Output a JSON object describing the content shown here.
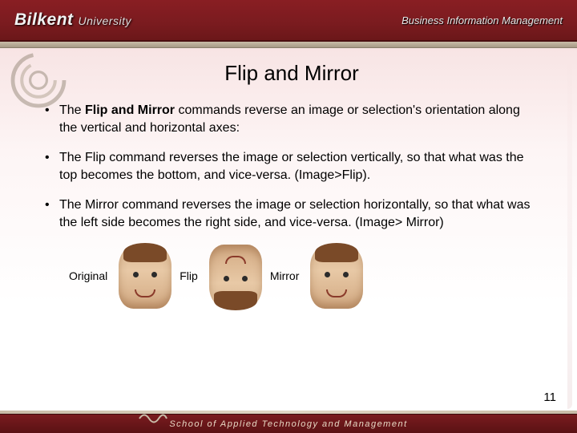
{
  "header": {
    "brand_main": "Bilkent",
    "brand_sub": "University",
    "department": "Business Information Management"
  },
  "slide": {
    "title": "Flip and Mirror",
    "bullets": [
      {
        "pre": "The ",
        "bold": "Flip and Mirror",
        "post": " commands reverse an image or selection's orientation along the vertical and horizontal axes:"
      },
      {
        "pre": "",
        "bold": "",
        "post": "The Flip command reverses the image or selection vertically, so that what was the top becomes the bottom, and vice-versa. (Image>Flip)."
      },
      {
        "pre": "",
        "bold": "",
        "post": "The Mirror command reverses the image or selection horizontally, so that what was the left side becomes the right side, and vice-versa. (Image> Mirror)"
      }
    ],
    "examples": {
      "original": "Original",
      "flip": "Flip",
      "mirror": "Mirror"
    },
    "page_number": "11"
  },
  "footer": {
    "text": "School of Applied Technology and Management"
  }
}
